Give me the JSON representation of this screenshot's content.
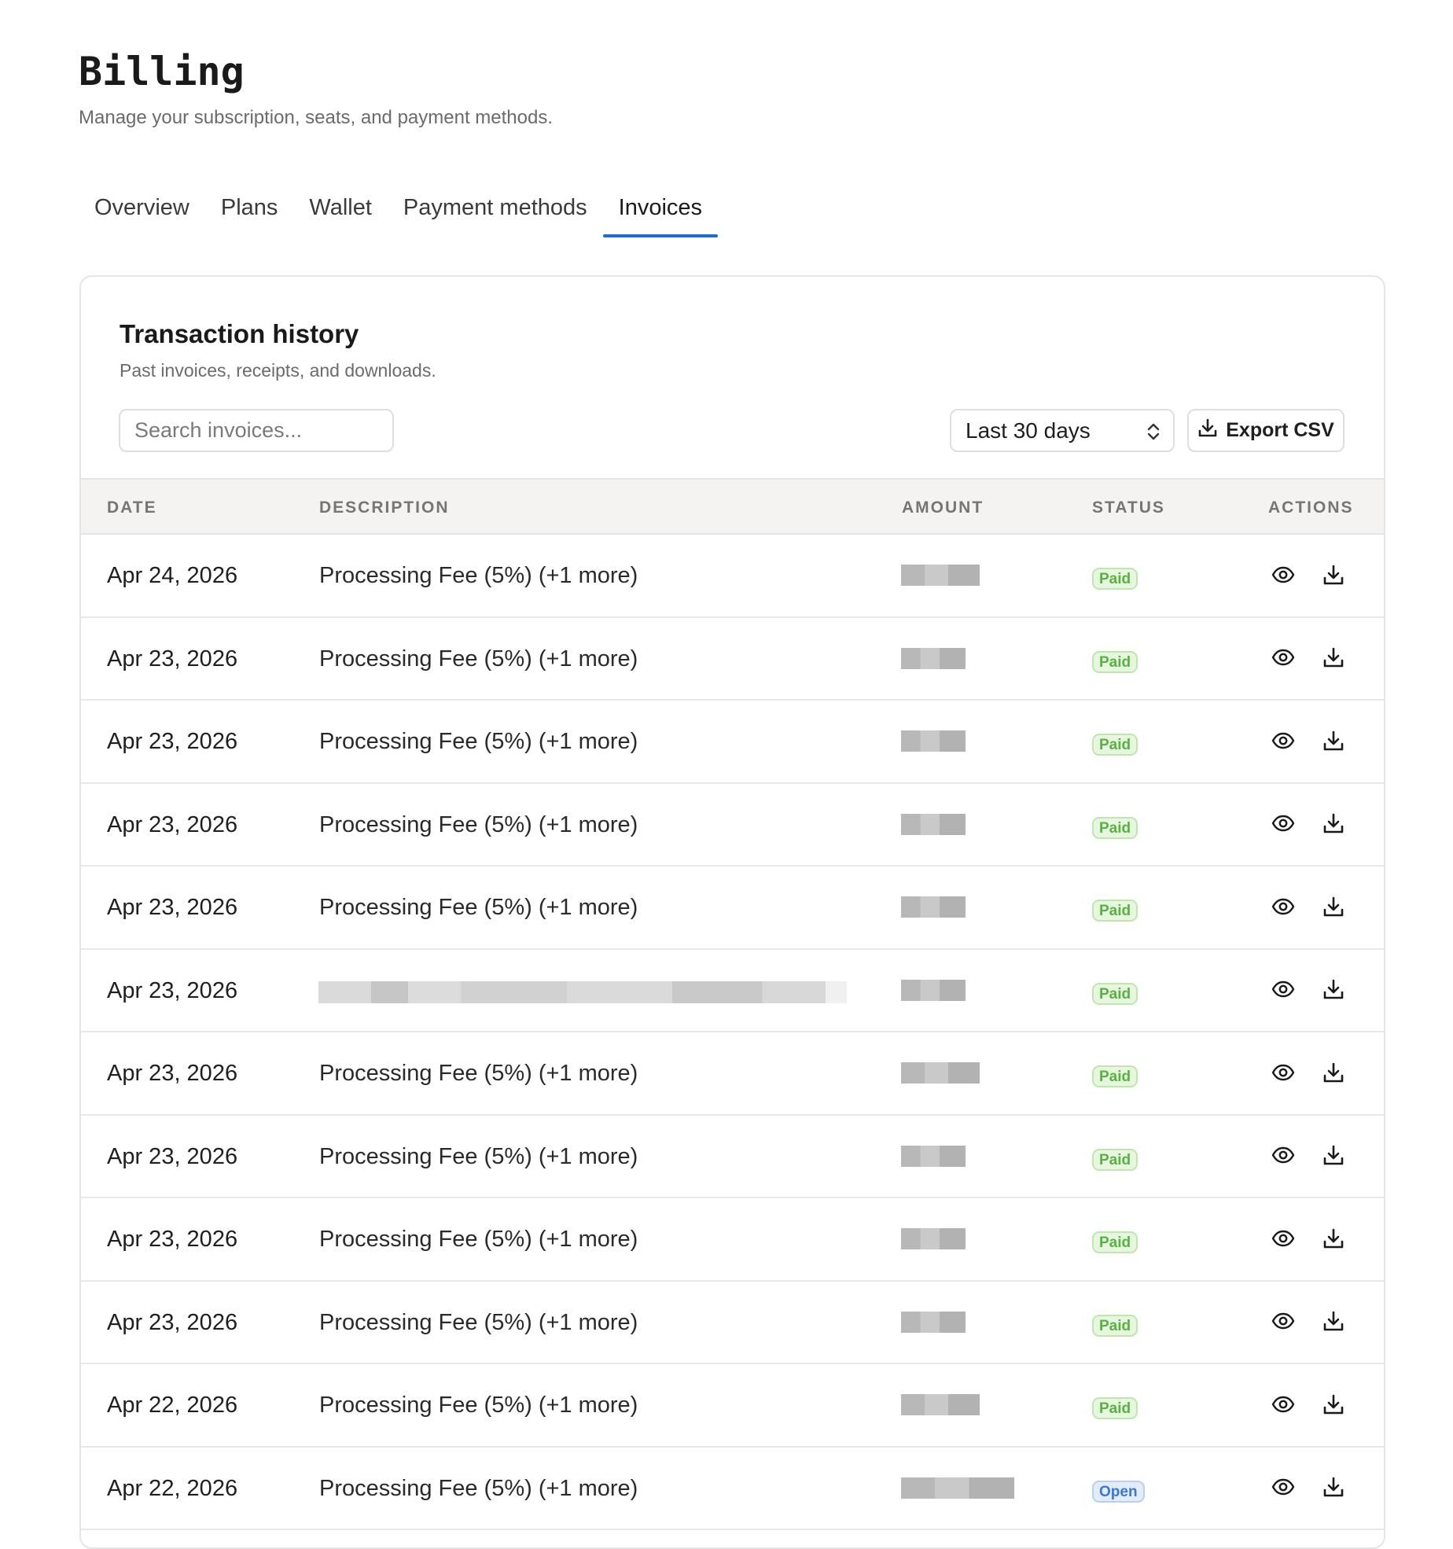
{
  "header": {
    "title": "Billing",
    "subtitle": "Manage your subscription, seats, and payment methods."
  },
  "tabs": [
    {
      "label": "Overview",
      "active": false
    },
    {
      "label": "Plans",
      "active": false
    },
    {
      "label": "Wallet",
      "active": false
    },
    {
      "label": "Payment methods",
      "active": false
    },
    {
      "label": "Invoices",
      "active": true
    }
  ],
  "card": {
    "title": "Transaction history",
    "subtitle": "Past invoices, receipts, and downloads.",
    "search": {
      "placeholder": "Search invoices...",
      "value": ""
    },
    "range": {
      "selected": "Last 30 days"
    },
    "export_label": "Export CSV"
  },
  "table": {
    "columns": [
      "DATE",
      "DESCRIPTION",
      "AMOUNT",
      "STATUS",
      "ACTIONS"
    ],
    "rows": [
      {
        "date": "Apr 24, 2026",
        "description": "Processing Fee (5%) (+1 more)",
        "status": "Paid"
      },
      {
        "date": "Apr 23, 2026",
        "description": "Processing Fee (5%) (+1 more)",
        "status": "Paid"
      },
      {
        "date": "Apr 23, 2026",
        "description": "Processing Fee (5%) (+1 more)",
        "status": "Paid"
      },
      {
        "date": "Apr 23, 2026",
        "description": "Processing Fee (5%) (+1 more)",
        "status": "Paid"
      },
      {
        "date": "Apr 23, 2026",
        "description": "Processing Fee (5%) (+1 more)",
        "status": "Paid"
      },
      {
        "date": "Apr 23, 2026",
        "description": "",
        "status": "Paid"
      },
      {
        "date": "Apr 23, 2026",
        "description": "Processing Fee (5%) (+1 more)",
        "status": "Paid"
      },
      {
        "date": "Apr 23, 2026",
        "description": "Processing Fee (5%) (+1 more)",
        "status": "Paid"
      },
      {
        "date": "Apr 23, 2026",
        "description": "Processing Fee (5%) (+1 more)",
        "status": "Paid"
      },
      {
        "date": "Apr 23, 2026",
        "description": "Processing Fee (5%) (+1 more)",
        "status": "Paid"
      },
      {
        "date": "Apr 22, 2026",
        "description": "Processing Fee (5%) (+1 more)",
        "status": "Paid"
      },
      {
        "date": "Apr 22, 2026",
        "description": "Processing Fee (5%) (+1 more)",
        "status": "Open"
      }
    ]
  },
  "colors": {
    "accent": "#1f6bdc",
    "paid": "#57b340",
    "open": "#3777d6"
  },
  "icons": {
    "view": "eye-icon",
    "download": "download-icon",
    "range_chevron": "chevron-up-down-icon"
  }
}
